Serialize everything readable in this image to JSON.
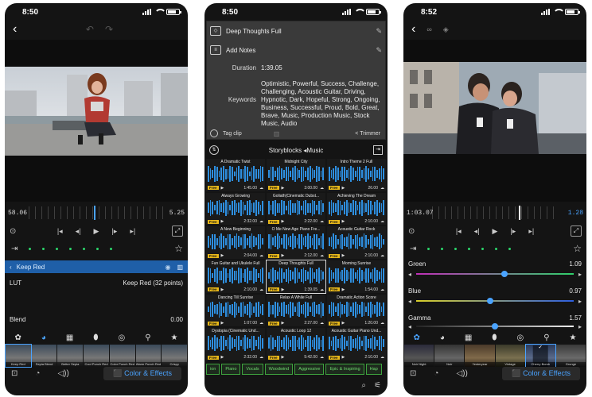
{
  "colors": {
    "accent": "#4aa3ff",
    "effect_bar": "#1f5fa8",
    "free_badge": "#e8b81a",
    "waveform": "#2e8fe0",
    "chip_green": "#3ea33e"
  },
  "phone1": {
    "time": "8:50",
    "timecode_left": "58.06",
    "timecode_right": "5.25",
    "effect_name": "Keep Red",
    "lut_label": "LUT",
    "lut_value": "Keep Red (32 points)",
    "blend_label": "Blend",
    "blend_value": "0.00",
    "filmstrip": [
      {
        "label": "Keep Red"
      },
      {
        "label": "Sepia Blend"
      },
      {
        "label": "Better Sepia"
      },
      {
        "label": "Cool Punch Red"
      },
      {
        "label": "Color Punch Red"
      },
      {
        "label": "Warm Punch Red"
      },
      {
        "label": "Crispy"
      }
    ],
    "color_effects_label": "Color & Effects"
  },
  "phone2": {
    "time": "8:50",
    "clip_title": "Deep Thoughts Full",
    "add_notes": "Add Notes",
    "duration_label": "Duration",
    "duration_value": "1:39.05",
    "keywords_label": "Keywords",
    "keywords_value": "Optimistic, Powerful, Success, Challenge, Challenging, Acoustic Guitar, Driving, Hypnotic, Dark, Hopeful, Strong, Ongoing, Business, Successful, Proud, Bold, Great, Brave, Music, Production Music, Stock Music, Audio",
    "tag_clip": "Tag clip",
    "trimmer": "< Trimmer",
    "library_title": "Storyblocks ◂Music",
    "free_label": "Free",
    "tracks": [
      {
        "title": "A Dramatic Twist",
        "duration": "1:45.00"
      },
      {
        "title": "Midnight City",
        "duration": "3:00.00"
      },
      {
        "title": "Intro Theme 2 Full",
        "duration": "26.00"
      },
      {
        "title": "Always Growing",
        "duration": "2:32.00"
      },
      {
        "title": "Goliath(Cinematic Dubst...",
        "duration": "2:22.00"
      },
      {
        "title": "Achieving The Dream",
        "duration": "2:10.00"
      },
      {
        "title": "A New Beginning",
        "duration": "2:04.00"
      },
      {
        "title": "O Me New Age Piano Fre...",
        "duration": "2:12.00"
      },
      {
        "title": "Acoustic Guitar Rock",
        "duration": "2:10.00"
      },
      {
        "title": "Fun Guitar and Ukulele Full",
        "duration": "2:10.00"
      },
      {
        "title": "Deep Thoughts Full",
        "duration": "1:39.05"
      },
      {
        "title": "Morning Sunrise",
        "duration": "1:54.00"
      },
      {
        "title": "Dancing Till Sunrise",
        "duration": "1:07.00"
      },
      {
        "title": "Relax A While Full",
        "duration": "2:27.00"
      },
      {
        "title": "Dramatic Action Score",
        "duration": "1:20.00"
      },
      {
        "title": "Dystopia (Cinematic Und...",
        "duration": "2:32.00"
      },
      {
        "title": "Acoustic Loop 12",
        "duration": "5:42.00"
      },
      {
        "title": "Acoustic Guitar Piano Und...",
        "duration": "2:10.00"
      },
      {
        "title": "Live The Moment",
        "duration": ""
      },
      {
        "title": "Dreams Become Real",
        "duration": ""
      },
      {
        "title": "Top of the World Full",
        "duration": ""
      }
    ],
    "chips": [
      "ion",
      "Piano",
      "Vocals",
      "Woodwind",
      "Aggressive",
      "Epic & Inspiring",
      "Hap"
    ]
  },
  "phone3": {
    "time": "8:52",
    "timecode_left": "1:03.07",
    "timecode_right": "1.28",
    "sliders": [
      {
        "name": "Green",
        "value": "1.09",
        "level": 0.56
      },
      {
        "name": "Blue",
        "value": "0.97",
        "level": 0.47
      },
      {
        "name": "Gamma",
        "value": "1.57",
        "level": 0.5
      }
    ],
    "filmstrip": [
      {
        "label": "Noir Night"
      },
      {
        "label": "Noir"
      },
      {
        "label": "Yesteryear"
      },
      {
        "label": "Vintage"
      },
      {
        "label": "Cherry Bomb"
      },
      {
        "label": "Grunge"
      }
    ],
    "color_effects_label": "Color & Effects"
  }
}
